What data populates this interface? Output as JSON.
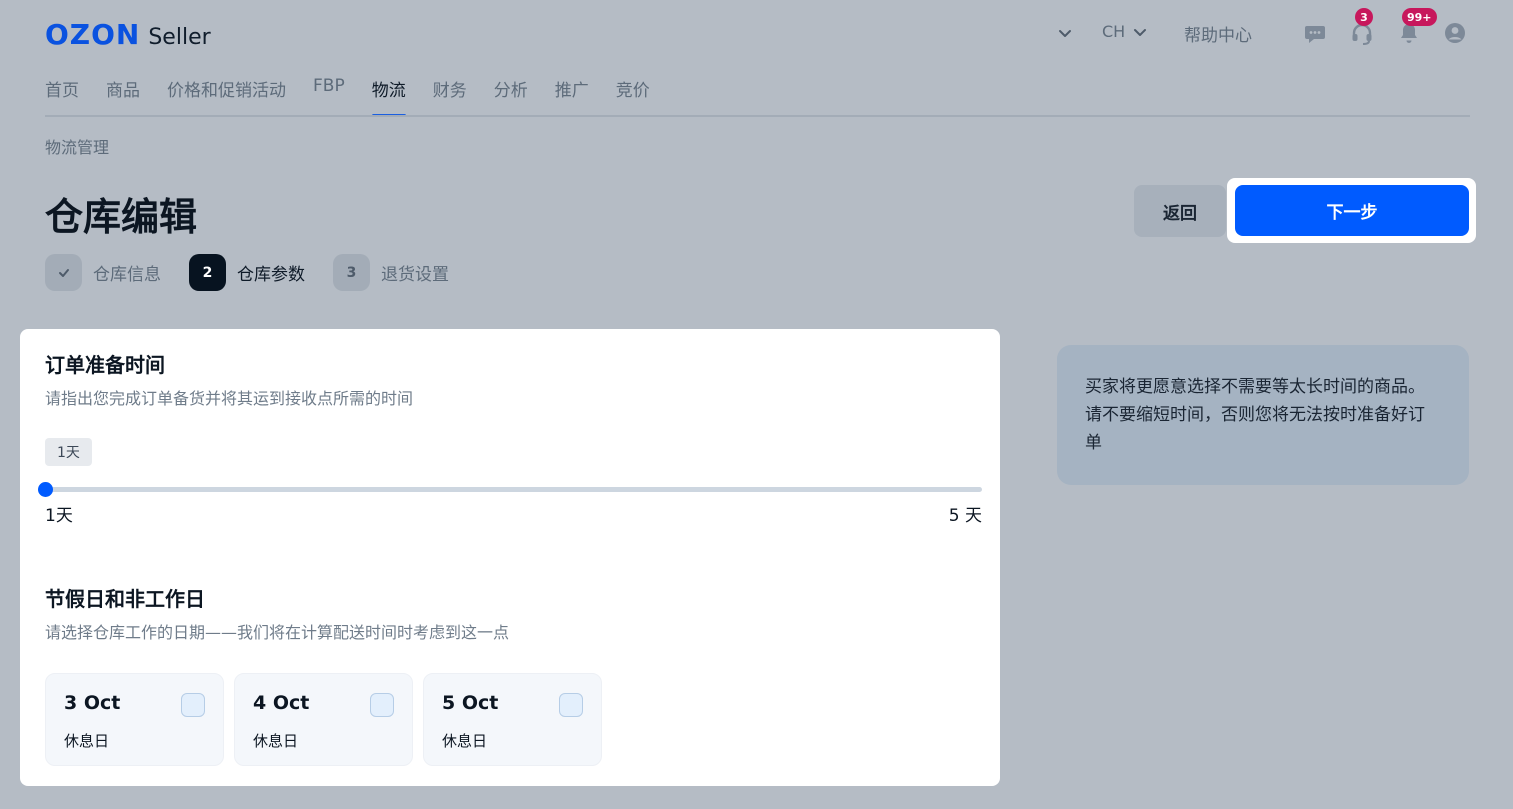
{
  "header": {
    "logo_brand": "OZON",
    "logo_suffix": "Seller",
    "lang": "CH",
    "help": "帮助中心",
    "support_badge": "3",
    "notifications_badge": "99+"
  },
  "nav": {
    "tabs": [
      {
        "label": "首页"
      },
      {
        "label": "商品"
      },
      {
        "label": "价格和促销活动"
      },
      {
        "label": "FBP"
      },
      {
        "label": "物流"
      },
      {
        "label": "财务"
      },
      {
        "label": "分析"
      },
      {
        "label": "推广"
      },
      {
        "label": "竞价"
      }
    ],
    "active_tab": "物流"
  },
  "breadcrumb": "物流管理",
  "page_title": "仓库编辑",
  "actions": {
    "back": "返回",
    "next": "下一步"
  },
  "steps": [
    {
      "number": "✓",
      "label": "仓库信息",
      "state": "done"
    },
    {
      "number": "2",
      "label": "仓库参数",
      "state": "current"
    },
    {
      "number": "3",
      "label": "退货设置",
      "state": "todo"
    }
  ],
  "prep_time": {
    "title": "订单准备时间",
    "subtitle": "请指出您完成订单备货并将其运到接收点所需的时间",
    "current_value": "1天",
    "min_label": "1天",
    "max_label": "5 天",
    "value_fraction": 0.0
  },
  "holidays": {
    "title": "节假日和非工作日",
    "subtitle": "请选择仓库工作的日期——我们将在计算配送时间时考虑到这一点",
    "days": [
      {
        "date": "3 Oct",
        "status": "休息日",
        "checked": false
      },
      {
        "date": "4 Oct",
        "status": "休息日",
        "checked": false
      },
      {
        "date": "5 Oct",
        "status": "休息日",
        "checked": false
      }
    ]
  },
  "info_panel": {
    "text": "买家将更愿意选择不需要等太长时间的商品。请不要缩短时间，否则您将无法按时准备好订单"
  },
  "colors": {
    "accent": "#005bff",
    "badge": "#c7175c",
    "overlay_bg": "#b5bcc5"
  }
}
